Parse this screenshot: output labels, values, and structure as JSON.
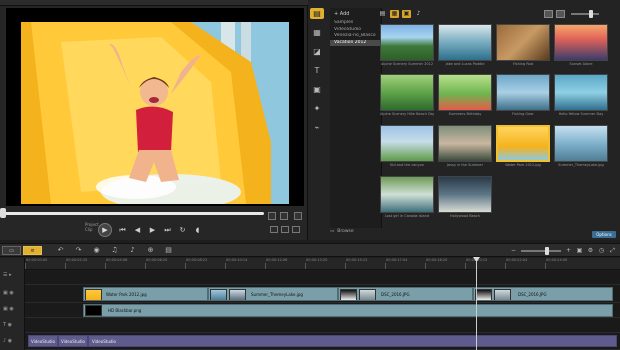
{
  "preview": {
    "project_label": "Project",
    "clip_label": "Clip"
  },
  "library": {
    "add_label": "Add",
    "folders": [
      "Samples",
      "VideoStudio",
      "Venezia-no_Blasco",
      "Vacation 2012"
    ],
    "selected_folder": 3,
    "browse_label": "Browse",
    "options_label": "Options",
    "thumbnails": [
      {
        "caption": "Alpine Scenery Summer 2012",
        "scene": "alpine"
      },
      {
        "caption": "Jake and Lucas Paddle",
        "scene": "lake"
      },
      {
        "caption": "Fishing Rod",
        "scene": "rod"
      },
      {
        "caption": "Sunset Alone",
        "scene": "sunset"
      },
      {
        "caption": "Alpine Scenery Hike Beach Day",
        "scene": "hike"
      },
      {
        "caption": "Summers Birthday",
        "scene": "birthday"
      },
      {
        "caption": "Fishing Gear",
        "scene": "rod2"
      },
      {
        "caption": "Hello Yellow Summer Day",
        "scene": "water"
      },
      {
        "caption": "Kid and the canyon",
        "scene": "bikes"
      },
      {
        "caption": "Jessy in the Summer",
        "scene": "family"
      },
      {
        "caption": "Water Park 2012.jpg",
        "scene": "slide"
      },
      {
        "caption": "Summer_ThemeyLake.jpg",
        "scene": "boat"
      },
      {
        "caption": "Lost girl in Canada Island",
        "scene": "island"
      },
      {
        "caption": "Hollywood Beach",
        "scene": "beach"
      }
    ]
  },
  "timeline": {
    "left_buttons": [
      "",
      ""
    ],
    "ruler": [
      "00:00:00:00",
      "00:00:02:15",
      "00:00:04:06",
      "00:00:06:20",
      "00:00:08:22",
      "00:00:10:14",
      "00:00:12:06",
      "00:00:13:20",
      "00:00:15:12",
      "00:00:17:04",
      "00:00:18:20",
      "00:00:20:12",
      "00:00:22:04",
      "00:00:24:00"
    ],
    "video_clips": [
      {
        "label": "Water Park 2012.jpg"
      },
      {
        "label": "Summer_ThemeyLake.jpg"
      },
      {
        "label": "DSC_2016.JPG"
      },
      {
        "label": "DSC_2016.JPG"
      }
    ],
    "overlay_clip": "HD Blackbar.png",
    "title_clips": [
      "VideoStudio",
      "VideoStudio",
      "VideoStudio"
    ]
  },
  "colors": {
    "accent": "#e0b030",
    "clip": "#7a9fa8",
    "title_clip": "#5f5b8c"
  }
}
